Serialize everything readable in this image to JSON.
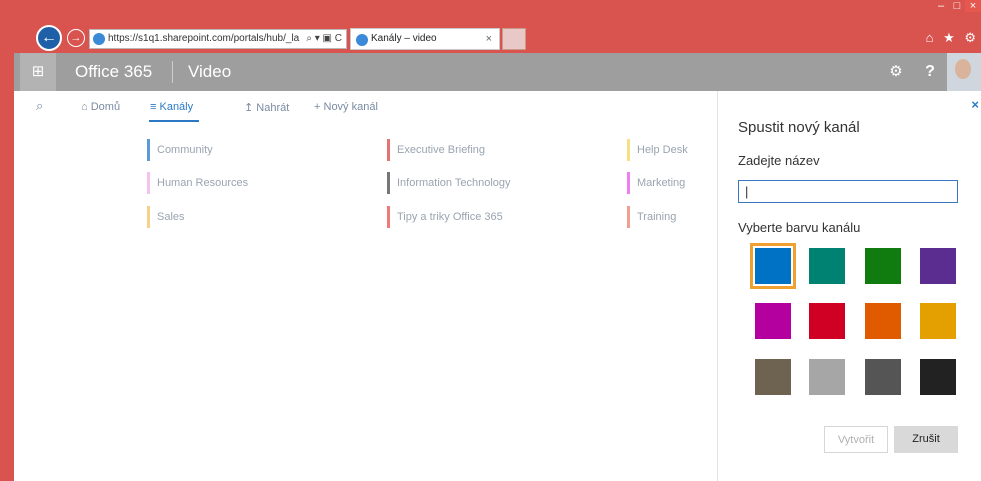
{
  "browser": {
    "url": "https://s1q1.sharepoint.com/portals/hub/_la",
    "tab_title": "Kanály – video",
    "addr_tools": "⌕ ▾ ▣ C",
    "tab_close": "×",
    "win_controls": {
      "minimize": "–",
      "maximize": "□",
      "close": "×"
    },
    "toolbar_icons": "⌂ ★ ⚙"
  },
  "o365": {
    "waffle": "⊞",
    "brand": "Office 365",
    "app": "Video",
    "gear": "⚙",
    "help": "?"
  },
  "nav": {
    "search_icon": "⌕",
    "home": "Domů",
    "home_icon": "⌂",
    "channels": "Kanály",
    "channels_icon": "≡",
    "upload": "Nahrát",
    "upload_icon": "↥",
    "new_channel": "Nový kanál",
    "new_channel_icon": "+"
  },
  "channels": [
    {
      "name": "Community",
      "color": "#5b9bd5"
    },
    {
      "name": "Executive Briefing",
      "color": "#e57373"
    },
    {
      "name": "Help Desk",
      "color": "#f7e082"
    },
    {
      "name": "Human Resources",
      "color": "#f5c2ef"
    },
    {
      "name": "Information Technology",
      "color": "#777777"
    },
    {
      "name": "Marketing",
      "color": "#f07ef0"
    },
    {
      "name": "Sales",
      "color": "#f7d18a"
    },
    {
      "name": "Tipy a triky Office 365",
      "color": "#f07a7a"
    },
    {
      "name": "Training",
      "color": "#f0a090"
    }
  ],
  "panel": {
    "title": "Spustit nový kanál",
    "name_label": "Zadejte název",
    "name_value": "|",
    "color_label": "Vyberte barvu kanálu",
    "close": "×",
    "colors": [
      "#0072c6",
      "#008272",
      "#107c10",
      "#5c2d91",
      "#b4009e",
      "#d00024",
      "#e05a00",
      "#e3a000",
      "#6e6250",
      "#a6a6a6",
      "#555555",
      "#222222"
    ],
    "selected_color": "#0072c6",
    "create_label": "Vytvořit",
    "cancel_label": "Zrušit"
  }
}
